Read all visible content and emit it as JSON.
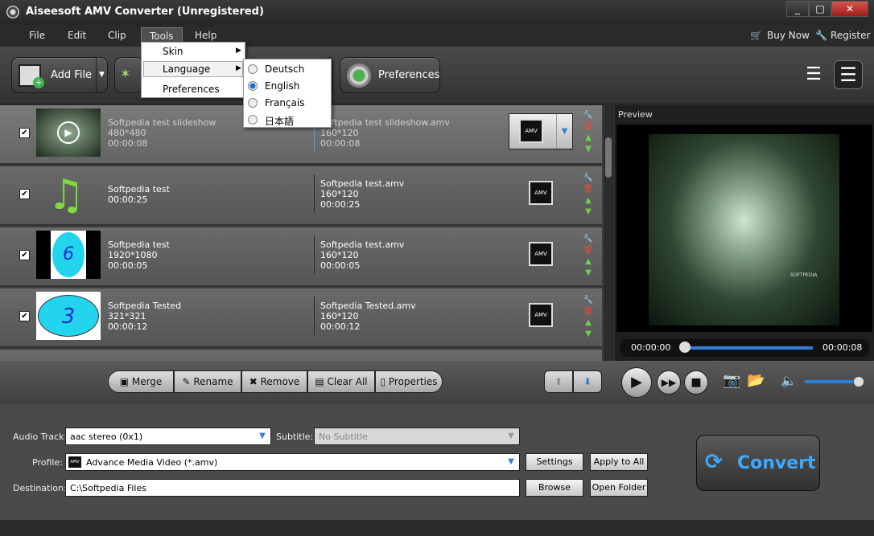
{
  "window": {
    "title": "Aiseesoft AMV Converter (Unregistered)",
    "min": "_",
    "max": "□",
    "close": "✕"
  },
  "menu": {
    "file": "File",
    "edit": "Edit",
    "clip": "Clip",
    "tools": "Tools",
    "help": "Help",
    "buy_now": "Buy Now",
    "register": "Register"
  },
  "tools_menu": {
    "skin": "Skin",
    "language": "Language",
    "preferences": "Preferences"
  },
  "language_menu": {
    "items": [
      "Deutsch",
      "English",
      "Français",
      "日本語"
    ],
    "selected": "English"
  },
  "toolbar": {
    "add_file": "Add File",
    "preferences": "Preferences"
  },
  "files": [
    {
      "name": "Softpedia test slideshow",
      "resolution": "480*480",
      "duration": "00:00:08",
      "out_name": "Softpedia test slideshow.amv",
      "out_res": "160*120",
      "out_duration": "00:00:08",
      "checked": true
    },
    {
      "name": "Softpedia test",
      "resolution": "",
      "duration": "00:00:25",
      "out_name": "Softpedia test.amv",
      "out_res": "160*120",
      "out_duration": "00:00:25",
      "checked": true
    },
    {
      "name": "Softpedia test",
      "resolution": "1920*1080",
      "duration": "00:00:05",
      "out_name": "Softpedia test.amv",
      "out_res": "160*120",
      "out_duration": "00:00:05",
      "checked": true
    },
    {
      "name": "Softpedia Tested",
      "resolution": "321*321",
      "duration": "00:00:12",
      "out_name": "Softpedia Tested.amv",
      "out_res": "160*120",
      "out_duration": "00:00:12",
      "checked": true
    }
  ],
  "thumb_text": {
    "row3": "6",
    "row4": "3"
  },
  "amv_badge": "AMV",
  "preview": {
    "label": "Preview",
    "time_current": "00:00:00",
    "time_total": "00:00:08",
    "watermark": "SOFTPEDIA"
  },
  "list_actions": {
    "merge": "Merge",
    "rename": "Rename",
    "remove": "Remove",
    "clear_all": "Clear All",
    "properties": "Properties"
  },
  "settings": {
    "audio_track_label": "Audio Track:",
    "audio_track_value": "aac stereo (0x1)",
    "subtitle_label": "Subtitle:",
    "subtitle_value": "No Subtitle",
    "profile_label": "Profile:",
    "profile_value": "Advance Media Video (*.amv)",
    "destination_label": "Destination:",
    "destination_value": "C:\\Softpedia Files",
    "settings_btn": "Settings",
    "apply_all_btn": "Apply to All",
    "browse_btn": "Browse",
    "open_folder_btn": "Open Folder"
  },
  "convert": "Convert",
  "colors": {
    "accent": "#3aa9ff",
    "bg": "#2e2e2e",
    "row": "#5e5e5e"
  }
}
